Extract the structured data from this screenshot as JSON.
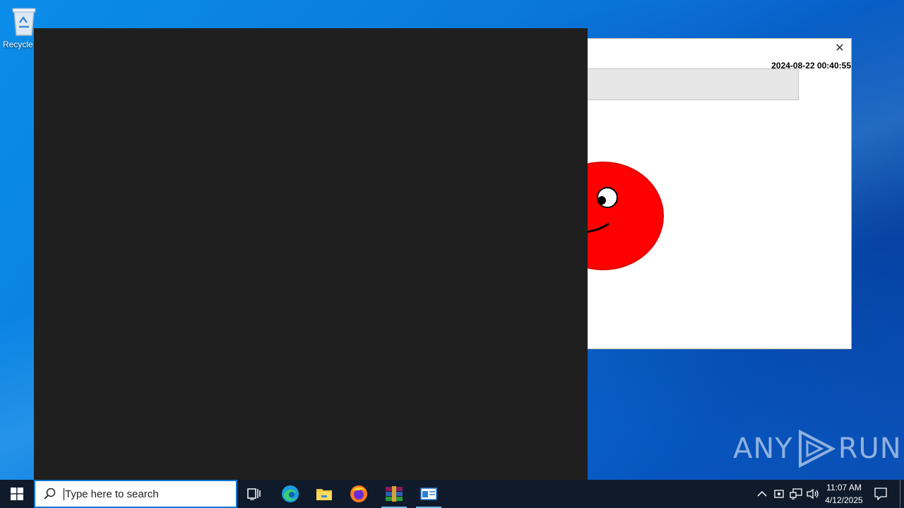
{
  "desktop": {
    "icons": [
      {
        "label": "Recycle Bin",
        "icon": "recycle-bin-icon"
      }
    ]
  },
  "prank_window": {
    "close_glyph": "✕",
    "timestamp": "2024-08-22 00:40:55",
    "face_color": "#ff0000"
  },
  "watermark": {
    "text_left": "ANY",
    "text_right": "RUN"
  },
  "taskbar": {
    "search_placeholder": "Type here to search",
    "apps": [
      "edge-icon",
      "file-explorer-icon",
      "firefox-icon",
      "winrar-icon",
      "active-window-icon"
    ],
    "clock_time": "11:07 AM",
    "clock_date": "4/12/2025"
  },
  "colors": {
    "taskbar_bg": "#0f1b2b",
    "dark_window_bg": "#1f1f1f",
    "accent": "#0b78d4"
  }
}
